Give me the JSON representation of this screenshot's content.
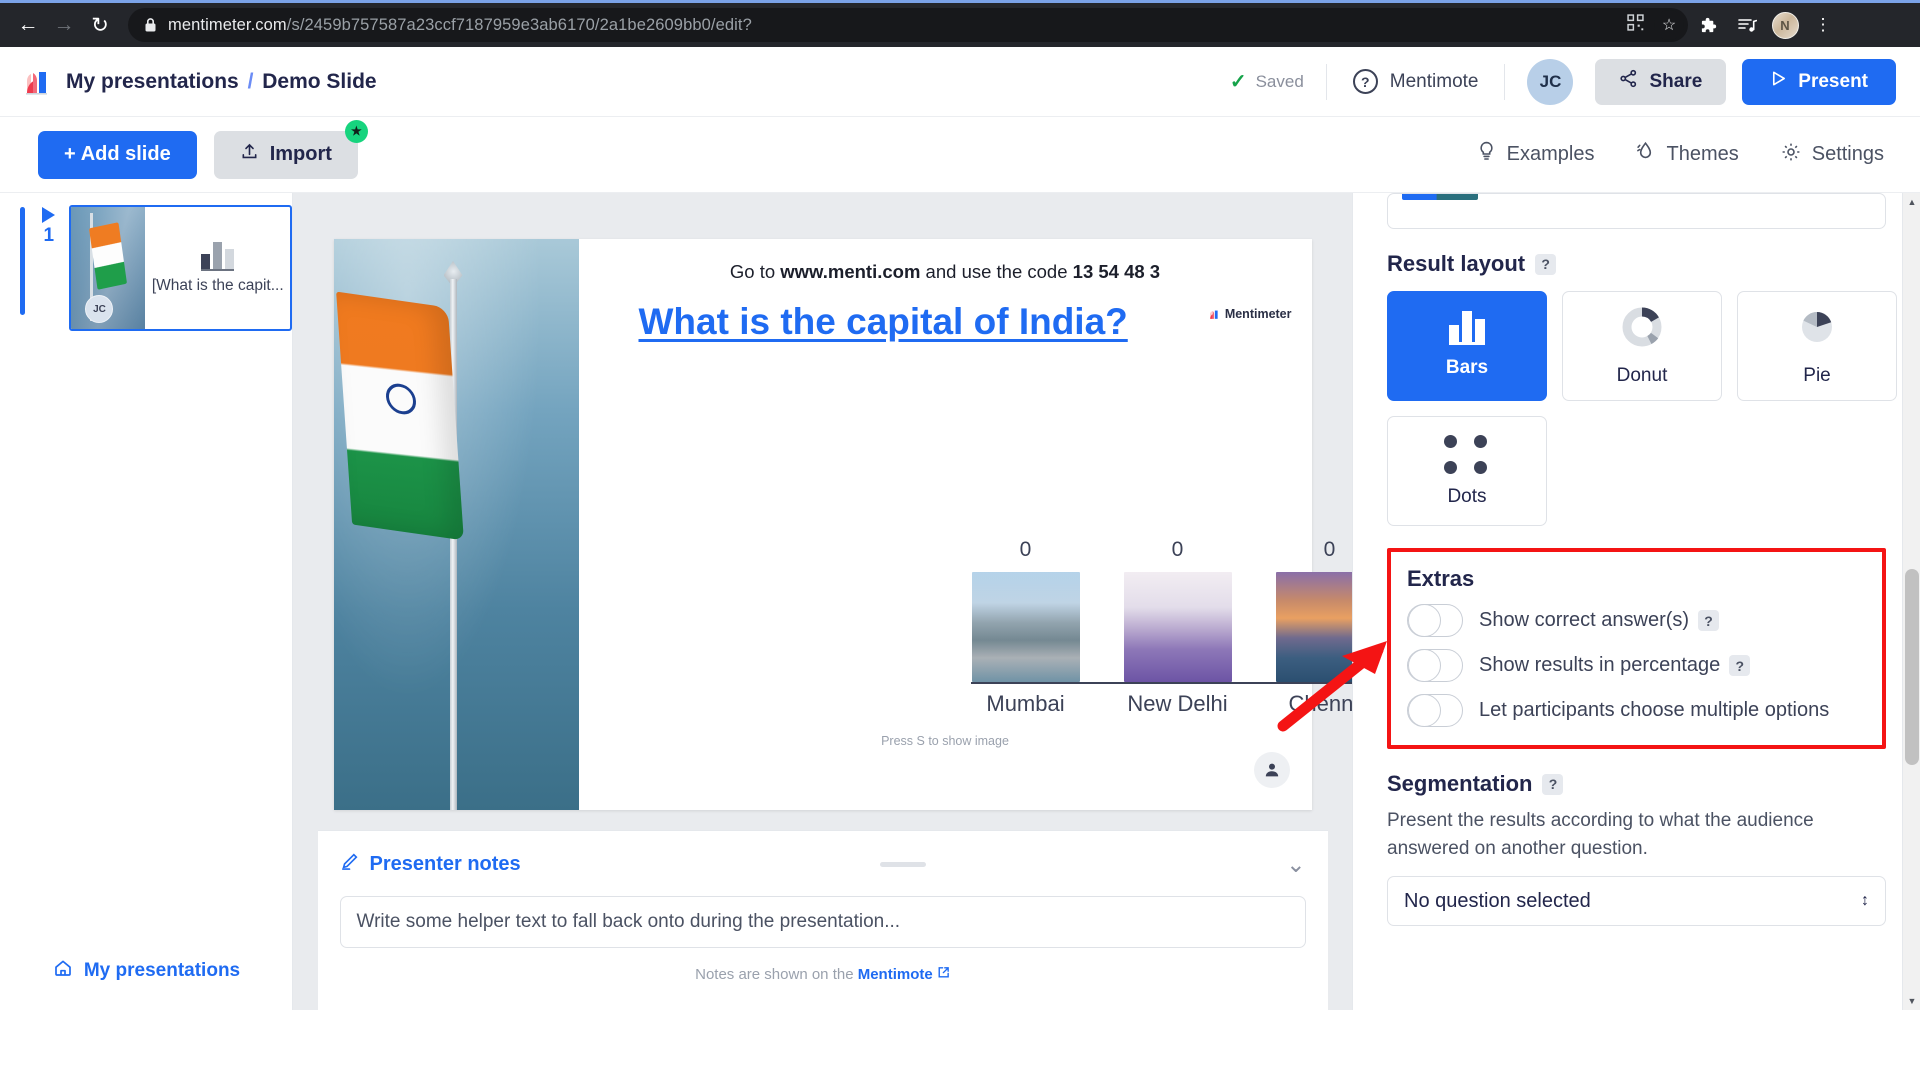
{
  "browser": {
    "back_icon": "back-arrow-icon",
    "forward_icon": "forward-arrow-icon",
    "reload_icon": "reload-icon",
    "lock_icon": "lock-icon",
    "url_prefix": "mentimeter.com",
    "url_path": "/s/2459b757587a23ccf7187959e3ab6170/2a1be2609bb0/edit?",
    "qr_icon": "qr-code-icon",
    "bookmark_icon": "star-icon",
    "extensions_icon": "puzzle-piece-icon",
    "reading_list_icon": "media-list-icon",
    "profile_initial": "N",
    "menu_icon": "three-dot-menu-icon"
  },
  "header": {
    "logo_icon": "mentimeter-logo-icon",
    "breadcrumb_root": "My presentations",
    "breadcrumb_separator": "/",
    "breadcrumb_current": "Demo Slide",
    "saved_label": "Saved",
    "saved_check_icon": "checkmark-icon",
    "mentimote_label": "Mentimote",
    "mentimote_icon": "question-circle-icon",
    "avatar_initials": "JC",
    "share_label": "Share",
    "share_icon": "share-nodes-icon",
    "present_label": "Present",
    "present_icon": "play-triangle-icon"
  },
  "toolbar": {
    "add_slide_label": "Add slide",
    "add_slide_plus": "+",
    "import_label": "Import",
    "import_icon": "upload-icon",
    "import_badge_icon": "star-badge-icon",
    "items": [
      {
        "label": "Examples",
        "icon": "lightbulb-icon"
      },
      {
        "label": "Themes",
        "icon": "water-drop-icon"
      },
      {
        "label": "Settings",
        "icon": "gear-icon"
      }
    ]
  },
  "sidebar": {
    "slide_number": "1",
    "slide_play_icon": "play-triangle-icon",
    "thumb_title": "[What is the capit...",
    "thumb_avatar_initials": "JC",
    "my_presentations_label": "My presentations",
    "home_icon": "home-icon"
  },
  "slide": {
    "menti_prefix": "Go to ",
    "menti_url": "www.menti.com",
    "menti_middle": " and use the code ",
    "menti_code": "13 54 48 3",
    "question": "What is the capital of India?",
    "watermark": "Mentimeter",
    "press_hint": "Press S to show image",
    "participant_icon": "participant-person-icon"
  },
  "chart_data": {
    "type": "bar",
    "categories": [
      "Mumbai",
      "New Delhi",
      "Chennai"
    ],
    "values": [
      0,
      0,
      0
    ],
    "value_labels": [
      "0",
      "0",
      "0"
    ],
    "title": "What is the capital of India?",
    "xlabel": "",
    "ylabel": "",
    "ylim": [
      0,
      1
    ],
    "grid": false,
    "legend": false,
    "image_options": true
  },
  "notes": {
    "title": "Presenter notes",
    "pencil_icon": "pencil-icon",
    "chevron_icon": "chevron-down-icon",
    "placeholder": "Write some helper text to fall back onto during the presentation...",
    "footer_prefix": "Notes are shown on the ",
    "footer_link": "Mentimote",
    "footer_link_icon": "external-link-icon"
  },
  "right_panel": {
    "result_layout": {
      "title": "Result layout",
      "help": "?",
      "options": [
        {
          "label": "Bars",
          "icon": "bar-chart-icon",
          "selected": true
        },
        {
          "label": "Donut",
          "icon": "donut-chart-icon",
          "selected": false
        },
        {
          "label": "Pie",
          "icon": "pie-chart-icon",
          "selected": false
        },
        {
          "label": "Dots",
          "icon": "dots-grid-icon",
          "selected": false
        }
      ]
    },
    "extras": {
      "title": "Extras",
      "highlight_color": "#f41414",
      "toggles": [
        {
          "label": "Show correct answer(s)",
          "help": "?",
          "on": false
        },
        {
          "label": "Show results in percentage",
          "help": "?",
          "on": false
        },
        {
          "label": "Let participants choose multiple options",
          "help": "",
          "on": false
        }
      ]
    },
    "segmentation": {
      "title": "Segmentation",
      "help": "?",
      "description": "Present the results according to what the audience answered on another question.",
      "select_value": "No question selected",
      "select_caret_icon": "chevron-updown-icon"
    },
    "scroll_up_icon": "scroll-up-arrow-icon",
    "scroll_down_icon": "scroll-down-arrow-icon"
  },
  "annotation": {
    "arrow_icon": "red-pointer-arrow",
    "color": "#f41414"
  }
}
